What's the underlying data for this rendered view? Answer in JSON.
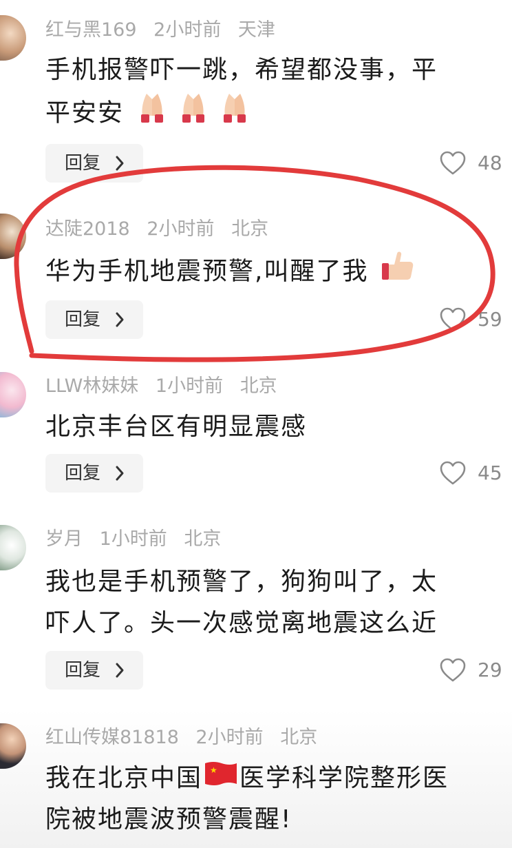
{
  "comments": [
    {
      "user": "红与黑169",
      "time": "2小时前",
      "location": "天津",
      "text_lines": [
        "手机报警吓一跳，希望都没事，平",
        "平安安"
      ],
      "likes": "48"
    },
    {
      "user": "达陡2018",
      "time": "2小时前",
      "location": "北京",
      "text_lines": [
        "华为手机地震预警,叫醒了我"
      ],
      "likes": "59"
    },
    {
      "user": "LLW林妹妹",
      "time": "1小时前",
      "location": "北京",
      "text_lines": [
        "北京丰台区有明显震感"
      ],
      "likes": "45"
    },
    {
      "user": "岁月",
      "time": "1小时前",
      "location": "北京",
      "text_lines": [
        "我也是手机预警了，狗狗叫了，太",
        "吓人了。头一次感觉离地震这么近"
      ],
      "likes": "29"
    },
    {
      "user": "红山传媒81818",
      "time": "2小时前",
      "location": "北京",
      "text_lines": [
        "我在北京中国",
        "医学科学院整形医",
        "院被地震波预警震醒!"
      ],
      "likes": ""
    }
  ],
  "reply_label": "回复",
  "icons": {
    "pray": "folded-hands-emoji",
    "thumb": "thumbs-up-emoji",
    "flag": "china-flag-emoji",
    "heart": "heart-outline-icon",
    "chevron": "chevron-right-icon"
  },
  "colors": {
    "annotation": "#e23b3b",
    "meta": "#a9a9a9",
    "text": "#1b1b1b"
  }
}
